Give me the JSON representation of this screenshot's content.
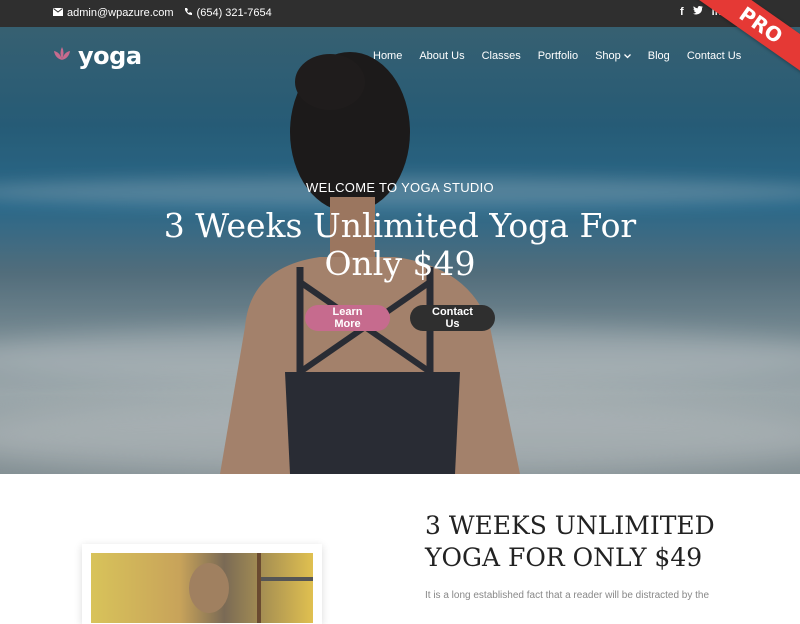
{
  "topbar": {
    "email": "admin@wpazure.com",
    "phone": "(654) 321-7654",
    "social": [
      "facebook-icon",
      "twitter-icon",
      "linkedin-icon"
    ]
  },
  "ribbon": {
    "label": "PRO",
    "color": "#e53935"
  },
  "brand": {
    "name": "yoga",
    "logo_icon": "lotus-icon",
    "accent": "#c66b8e"
  },
  "nav": {
    "items": [
      {
        "label": "Home"
      },
      {
        "label": "About Us"
      },
      {
        "label": "Classes"
      },
      {
        "label": "Portfolio"
      },
      {
        "label": "Shop",
        "has_dropdown": true
      },
      {
        "label": "Blog"
      },
      {
        "label": "Contact Us"
      }
    ]
  },
  "hero": {
    "eyebrow": "WELCOME TO YOGA STUDIO",
    "headline": "3 Weeks Unlimited Yoga For Only $49",
    "primary_button": "Learn More",
    "secondary_button": "Contact Us"
  },
  "section": {
    "title": "3 WEEKS UNLIMITED YOGA FOR ONLY $49",
    "text": "It is a long established fact that a reader will be distracted by the"
  }
}
